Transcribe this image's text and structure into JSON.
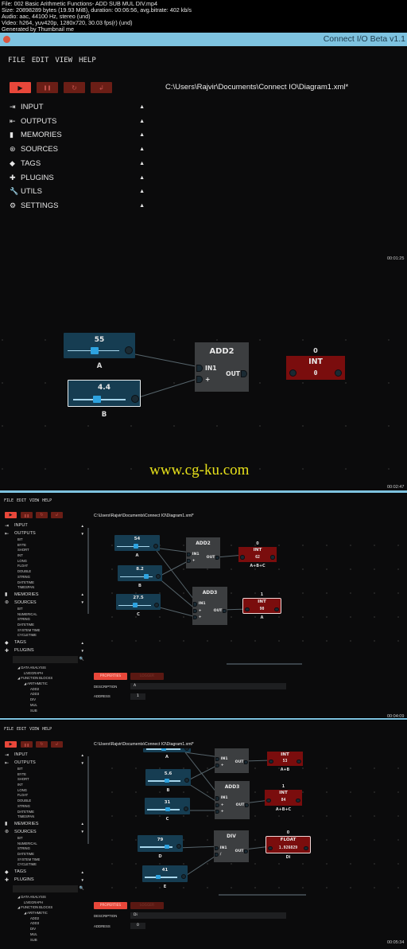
{
  "video_info": [
    "File: 002 Basic Arithmetic Functions- ADD SUB MUL DIV.mp4",
    "Size: 20898289 bytes (19.93 MiB), duration: 00:06:56, avg.bitrate: 402 kb/s",
    "Audio: aac, 44100 Hz, stereo (und)",
    "Video: h264, yuv420p, 1280x720, 30.03 fps(r) (und)",
    "Generated by Thumbnail me"
  ],
  "window": {
    "title": "Connect I/O Beta v1.1",
    "icon": "app-logo-icon"
  },
  "menu": [
    "FILE",
    "EDIT",
    "VIEW",
    "HELP"
  ],
  "toolbar": {
    "icons": [
      "play-icon",
      "pause-icon",
      "reset-icon",
      "step-icon"
    ],
    "glyphs": [
      "▶",
      "❚❚",
      "↻",
      "↲"
    ]
  },
  "colors": {
    "accent": "#e8473a",
    "slider_node": "#163d52",
    "output_node": "#7a0d0d",
    "block_node": "#3c3e40",
    "titlebar": "#7ec3e0"
  },
  "sidebar_collapsed": [
    {
      "label": "INPUT",
      "icon": "input-icon",
      "glyph": "⇥",
      "arrow": "▲"
    },
    {
      "label": "OUTPUTS",
      "icon": "outputs-icon",
      "glyph": "⇤",
      "arrow": "▲"
    },
    {
      "label": "MEMORIES",
      "icon": "memories-icon",
      "glyph": "▮",
      "arrow": "▲"
    },
    {
      "label": "SOURCES",
      "icon": "sources-icon",
      "glyph": "⊛",
      "arrow": "▲"
    },
    {
      "label": "TAGS",
      "icon": "tags-icon",
      "glyph": "◆",
      "arrow": "▲"
    },
    {
      "label": "PLUGINS",
      "icon": "plugins-icon",
      "glyph": "✚",
      "arrow": "▲"
    },
    {
      "label": "UTILS",
      "icon": "wrench-icon",
      "glyph": "🔧",
      "arrow": "▲"
    },
    {
      "label": "SETTINGS",
      "icon": "settings-icon",
      "glyph": "⚙",
      "arrow": "▲"
    }
  ],
  "sidebar_expanded": [
    {
      "label": "INPUT",
      "icon": "input-icon",
      "glyph": "⇥",
      "arrow": "▲",
      "children": []
    },
    {
      "label": "OUTPUTS",
      "icon": "outputs-icon",
      "glyph": "⇤",
      "arrow": "▼",
      "children": [
        "BIT",
        "BYTE",
        "SHORT",
        "INT",
        "LONG",
        "FLOAT",
        "DOUBLE",
        "STRING",
        "DATETIME",
        "TIMESPAN"
      ]
    },
    {
      "label": "MEMORIES",
      "icon": "memories-icon",
      "glyph": "▮",
      "arrow": "▲",
      "children": []
    },
    {
      "label": "SOURCES",
      "icon": "sources-icon",
      "glyph": "⊛",
      "arrow": "▼",
      "children": [
        "BIT",
        "NUMERICAL",
        "STRING",
        "DATETIME",
        "SYSTEM TIME",
        "CYCLETIME"
      ]
    },
    {
      "label": "TAGS",
      "icon": "tags-icon",
      "glyph": "◆",
      "arrow": "▲",
      "children": []
    },
    {
      "label": "PLUGINS",
      "icon": "plugins-icon",
      "glyph": "✚",
      "arrow": "▼",
      "children": []
    }
  ],
  "plugin_tree": [
    {
      "label": "DATA ANALYSIS",
      "level": 1,
      "expanded": true
    },
    {
      "label": "LIVEGRAPH",
      "level": 2
    },
    {
      "label": "FUNCTION BLOCKS",
      "level": 1,
      "expanded": true
    },
    {
      "label": "ARITHMETIC",
      "level": 2,
      "expanded": true
    },
    {
      "label": "ADD2",
      "level": 3
    },
    {
      "label": "ADD3",
      "level": 3
    },
    {
      "label": "DIV",
      "level": 3
    },
    {
      "label": "MUL",
      "level": 3
    },
    {
      "label": "SUB",
      "level": 3
    }
  ],
  "search_icon": "search-icon",
  "properties_panel": {
    "tabs": [
      "PROPERTIES",
      "LOGGER"
    ],
    "description_label": "DESCRIPTION",
    "address_label": "ADDRESS"
  },
  "watermark": "www.cg-ku.com",
  "frames": [
    {
      "path": "C:\\Users\\Rajvir\\Documents\\Connect IO\\Diagram1.xml*",
      "timestamps": [
        "00:01:25",
        "00:02:47"
      ],
      "nodes": [
        {
          "kind": "slider",
          "value": "55",
          "label": "A",
          "level": 0.5,
          "selected": false
        },
        {
          "kind": "slider",
          "value": "4.4",
          "label": "B",
          "level": 0.45,
          "selected": true
        },
        {
          "kind": "block",
          "title": "ADD2",
          "inputs": [
            "IN1",
            "+"
          ],
          "output": "OUT"
        },
        {
          "kind": "output",
          "type": "INT",
          "value": "0",
          "address": "0",
          "label": "",
          "selected": false
        }
      ]
    },
    {
      "path": "C:\\Users\\Rajvir\\Documents\\Connect IO\\Diagram1.xml*",
      "timestamps": [
        "00:04:09"
      ],
      "description_value": "A",
      "address_value": "1",
      "nodes": [
        {
          "kind": "slider",
          "value": "54",
          "label": "A",
          "level": 0.55,
          "selected": false
        },
        {
          "kind": "slider",
          "value": "8.2",
          "label": "B",
          "level": 0.8,
          "selected": false
        },
        {
          "kind": "slider",
          "value": "27.5",
          "label": "C",
          "level": 0.5,
          "selected": false
        },
        {
          "kind": "block",
          "title": "ADD2",
          "inputs": [
            "IN1",
            "+"
          ],
          "output": "OUT"
        },
        {
          "kind": "block",
          "title": "ADD3",
          "inputs": [
            "IN1",
            "+",
            "+"
          ],
          "output": "OUT"
        },
        {
          "kind": "output",
          "type": "INT",
          "value": "62",
          "address": "0",
          "label": "A+B+C",
          "selected": false
        },
        {
          "kind": "output",
          "type": "INT",
          "value": "90",
          "address": "1",
          "label": "A",
          "selected": true
        }
      ]
    },
    {
      "path": "C:\\Users\\Rajvir\\Documents\\Connect IO\\Diagram1.xml*",
      "timestamps": [
        "00:05:34"
      ],
      "description_value": "Di",
      "address_value": "0",
      "nodes": [
        {
          "kind": "slider",
          "value": "",
          "label": "A",
          "level": 0.5,
          "selected": false
        },
        {
          "kind": "slider",
          "value": "5.6",
          "label": "B",
          "level": 0.55,
          "selected": false
        },
        {
          "kind": "slider",
          "value": "31",
          "label": "C",
          "level": 0.6,
          "selected": false
        },
        {
          "kind": "slider",
          "value": "79",
          "label": "D",
          "level": 0.8,
          "selected": false
        },
        {
          "kind": "slider",
          "value": "41",
          "label": "E",
          "level": 0.4,
          "selected": false
        },
        {
          "kind": "block",
          "title": "",
          "inputs": [
            "IN1",
            "+"
          ],
          "output": "OUT"
        },
        {
          "kind": "block",
          "title": "ADD3",
          "inputs": [
            "IN1",
            "+",
            "+"
          ],
          "output": "OUT"
        },
        {
          "kind": "block",
          "title": "DIV",
          "inputs": [
            "IN1",
            "/"
          ],
          "output": "OUT"
        },
        {
          "kind": "output",
          "type": "INT",
          "value": "53",
          "address": "",
          "label": "A+B",
          "selected": false
        },
        {
          "kind": "output",
          "type": "INT",
          "value": "84",
          "address": "1",
          "label": "A+B+C",
          "selected": false
        },
        {
          "kind": "output",
          "type": "FLOAT",
          "value": "1.926829",
          "address": "0",
          "label": "Di",
          "selected": true
        }
      ]
    }
  ]
}
